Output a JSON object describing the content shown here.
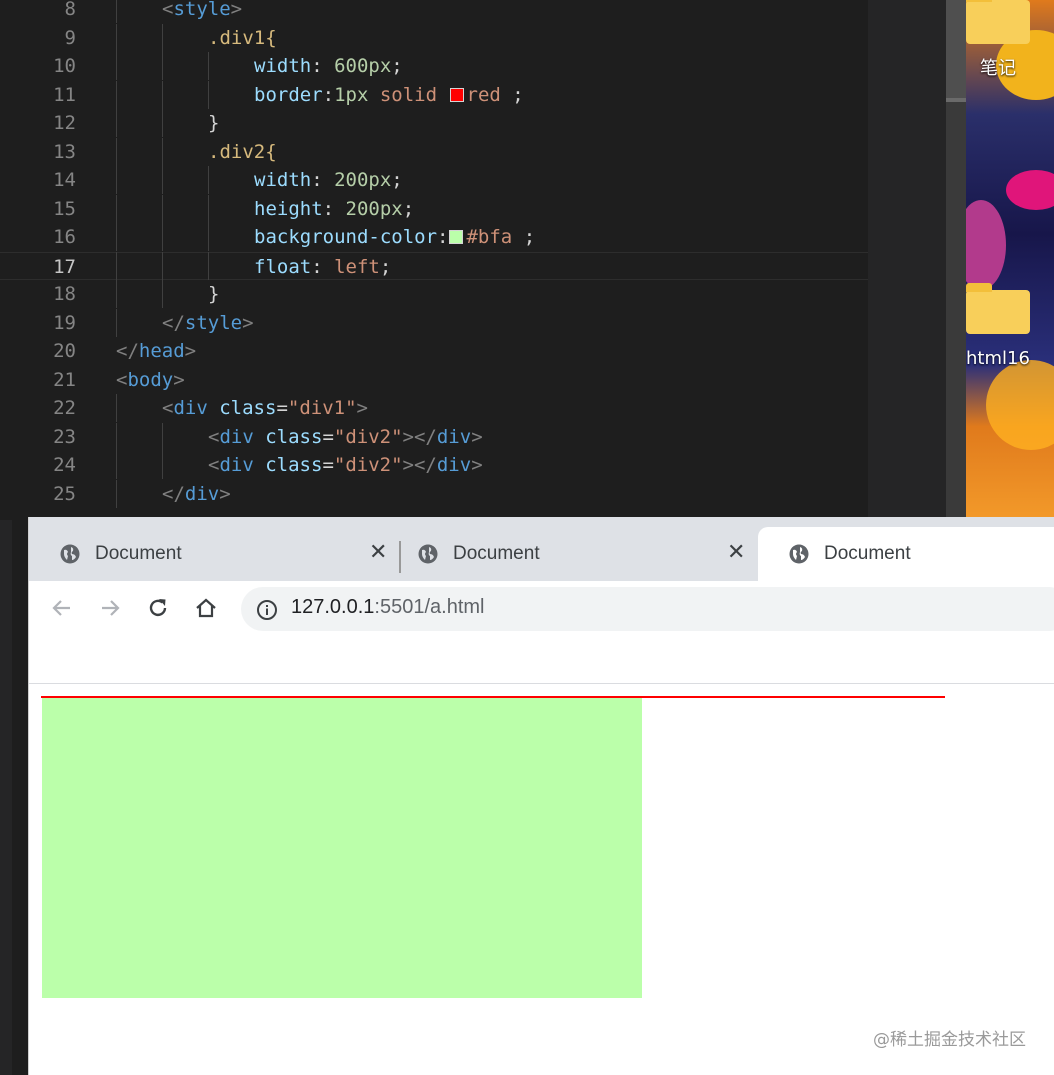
{
  "editor": {
    "lines": [
      {
        "n": "8",
        "tokens": [
          {
            "t": "&lt;",
            "c": "t-punc"
          }
        ]
      },
      {
        "n": "9"
      },
      {
        "n": "10"
      },
      {
        "n": "11"
      },
      {
        "n": "12"
      },
      {
        "n": "13"
      },
      {
        "n": "14"
      },
      {
        "n": "15"
      },
      {
        "n": "16"
      },
      {
        "n": "17"
      },
      {
        "n": "18"
      },
      {
        "n": "19"
      },
      {
        "n": "20"
      },
      {
        "n": "21"
      },
      {
        "n": "22"
      },
      {
        "n": "23"
      },
      {
        "n": "24"
      },
      {
        "n": "25"
      }
    ],
    "code": [
      [
        [
          "<",
          "t-punc"
        ],
        [
          "style",
          "t-tag"
        ],
        [
          ">",
          "t-punc"
        ]
      ],
      [
        [
          ".div1{",
          "t-sel"
        ]
      ],
      [
        [
          "width",
          "t-prop"
        ],
        [
          ": ",
          "t-txt"
        ],
        [
          "600px",
          "t-num"
        ],
        [
          ";",
          "t-txt"
        ]
      ],
      [
        [
          "border",
          "t-prop"
        ],
        [
          ":",
          "t-txt"
        ],
        [
          "1px",
          "t-num"
        ],
        [
          " solid ",
          "t-val"
        ],
        [
          "SWATCH:#ff0000",
          ""
        ],
        [
          "red",
          "t-val"
        ],
        [
          " ;",
          "t-txt"
        ]
      ],
      [
        [
          "}",
          "t-txt"
        ]
      ],
      [
        [
          ".div2{",
          "t-sel"
        ]
      ],
      [
        [
          "width",
          "t-prop"
        ],
        [
          ": ",
          "t-txt"
        ],
        [
          "200px",
          "t-num"
        ],
        [
          ";",
          "t-txt"
        ]
      ],
      [
        [
          "height",
          "t-prop"
        ],
        [
          ": ",
          "t-txt"
        ],
        [
          "200px",
          "t-num"
        ],
        [
          ";",
          "t-txt"
        ]
      ],
      [
        [
          "background-color",
          "t-prop"
        ],
        [
          ":",
          "t-txt"
        ],
        [
          "SWATCH:#bbffaa",
          ""
        ],
        [
          "#bfa",
          "t-val"
        ],
        [
          " ;",
          "t-txt"
        ]
      ],
      [
        [
          "float",
          "t-prop"
        ],
        [
          ": ",
          "t-txt"
        ],
        [
          "left",
          "t-val"
        ],
        [
          ";",
          "t-txt"
        ]
      ],
      [
        [
          "}",
          "t-txt"
        ]
      ],
      [
        [
          "</",
          "t-punc"
        ],
        [
          "style",
          "t-tag"
        ],
        [
          ">",
          "t-punc"
        ]
      ],
      [
        [
          "</",
          "t-punc"
        ],
        [
          "head",
          "t-tag"
        ],
        [
          ">",
          "t-punc"
        ]
      ],
      [
        [
          "<",
          "t-punc"
        ],
        [
          "body",
          "t-tag"
        ],
        [
          ">",
          "t-punc"
        ]
      ],
      [
        [
          "<",
          "t-punc"
        ],
        [
          "div",
          "t-tag"
        ],
        [
          " ",
          "t-txt"
        ],
        [
          "class",
          "t-attr"
        ],
        [
          "=",
          "t-txt"
        ],
        [
          "\"div1\"",
          "t-str"
        ],
        [
          ">",
          "t-punc"
        ]
      ],
      [
        [
          "<",
          "t-punc"
        ],
        [
          "div",
          "t-tag"
        ],
        [
          " ",
          "t-txt"
        ],
        [
          "class",
          "t-attr"
        ],
        [
          "=",
          "t-txt"
        ],
        [
          "\"div2\"",
          "t-str"
        ],
        [
          "></",
          "t-punc"
        ],
        [
          "div",
          "t-tag"
        ],
        [
          ">",
          "t-punc"
        ]
      ],
      [
        [
          "<",
          "t-punc"
        ],
        [
          "div",
          "t-tag"
        ],
        [
          " ",
          "t-txt"
        ],
        [
          "class",
          "t-attr"
        ],
        [
          "=",
          "t-txt"
        ],
        [
          "\"div2\"",
          "t-str"
        ],
        [
          "></",
          "t-punc"
        ],
        [
          "div",
          "t-tag"
        ],
        [
          ">",
          "t-punc"
        ]
      ],
      [
        [
          "</",
          "t-punc"
        ],
        [
          "div",
          "t-tag"
        ],
        [
          ">",
          "t-punc"
        ]
      ]
    ],
    "indent_levels": [
      1,
      2,
      3,
      3,
      2,
      2,
      3,
      3,
      3,
      3,
      2,
      1,
      0,
      0,
      1,
      2,
      2,
      1
    ],
    "current_line": "17"
  },
  "desktop": {
    "icons": [
      {
        "label": "笔记"
      },
      {
        "label": "html16"
      }
    ]
  },
  "browser": {
    "tabs": [
      {
        "title": "Document",
        "active": false
      },
      {
        "title": "Document",
        "active": false
      },
      {
        "title": "Document",
        "active": true
      }
    ],
    "close_glyph": "✕",
    "url_host": "127.0.0.1",
    "url_rest": ":5501/a.html"
  },
  "watermark": "@稀土掘金技术社区",
  "colors": {
    "div1_border": "#ff0000",
    "div2_background": "#bbffaa"
  }
}
